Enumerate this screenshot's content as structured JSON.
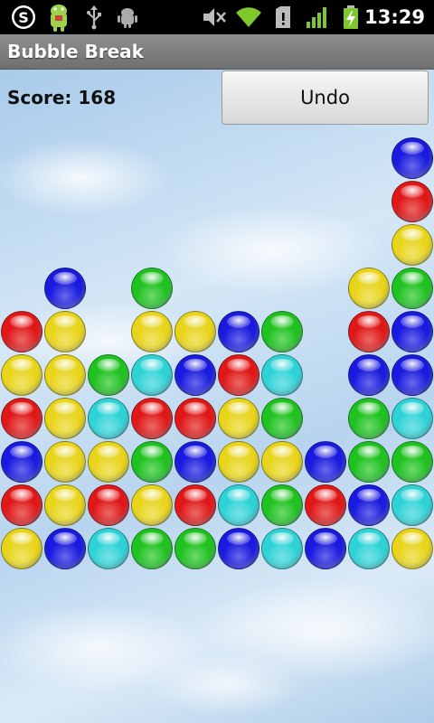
{
  "status_bar": {
    "time": "13:29",
    "icons": [
      "skype-icon",
      "android-mascot-icon",
      "usb-icon",
      "android-debug-icon",
      "mute-icon",
      "wifi-icon",
      "sd-card-icon",
      "signal-icon",
      "battery-charging-icon"
    ]
  },
  "app": {
    "title": "Bubble Break"
  },
  "game": {
    "score_text": "Score: 168",
    "undo_label": "Undo"
  },
  "colors": {
    "red": "#e01818",
    "yellow": "#e8d41a",
    "green": "#1fc21f",
    "blue": "#1a1adf",
    "cyan": "#2fd3d6"
  },
  "board": {
    "columns": 10,
    "rows": [
      [
        "",
        "",
        "",
        "",
        "",
        "",
        "",
        "",
        "",
        "blue"
      ],
      [
        "",
        "",
        "",
        "",
        "",
        "",
        "",
        "",
        "",
        "red"
      ],
      [
        "",
        "",
        "",
        "",
        "",
        "",
        "",
        "",
        "",
        "yellow"
      ],
      [
        "",
        "blue",
        "",
        "green",
        "",
        "",
        "",
        "",
        "yellow",
        "green"
      ],
      [
        "red",
        "yellow",
        "",
        "yellow",
        "yellow",
        "blue",
        "green",
        "",
        "red",
        "blue"
      ],
      [
        "yellow",
        "yellow",
        "green",
        "cyan",
        "blue",
        "red",
        "cyan",
        "",
        "blue",
        "blue"
      ],
      [
        "red",
        "yellow",
        "cyan",
        "red",
        "red",
        "yellow",
        "green",
        "",
        "green",
        "cyan"
      ],
      [
        "blue",
        "yellow",
        "yellow",
        "green",
        "blue",
        "yellow",
        "yellow",
        "blue",
        "green",
        "green"
      ],
      [
        "red",
        "yellow",
        "red",
        "yellow",
        "red",
        "cyan",
        "green",
        "red",
        "blue",
        "cyan"
      ],
      [
        "yellow",
        "blue",
        "cyan",
        "green",
        "green",
        "blue",
        "cyan",
        "blue",
        "cyan",
        "yellow"
      ]
    ]
  }
}
